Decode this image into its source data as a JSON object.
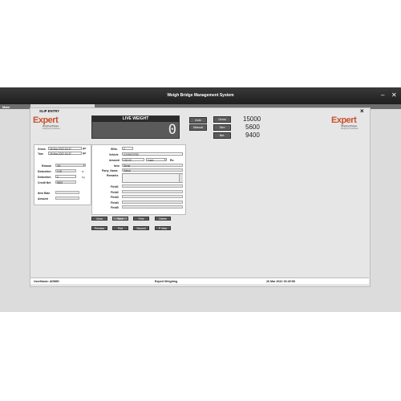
{
  "app": {
    "title": "Weigh Bridge Management System"
  },
  "menu": {
    "main": "Main",
    "strip": ""
  },
  "dialog": {
    "title": "SLIP ENTRY",
    "close": "×"
  },
  "window_controls": {
    "minimize": "–",
    "close": "✕"
  },
  "logo_left": {
    "brand": "Expert",
    "tagline": "Weighing Bridges",
    "sub": "Weighing Software"
  },
  "logo_right": {
    "brand": "Expert",
    "tagline": "Weighing Bridges",
    "sub": "Weighing Software"
  },
  "live_weight": {
    "label": "LIVE WEIGHT",
    "value": "0"
  },
  "mode_buttons": {
    "auto": "Auto",
    "manual": "Manual"
  },
  "weights": {
    "gross": {
      "label": "Gross",
      "value": "15000"
    },
    "tare": {
      "label": "Tare",
      "value": "5600"
    },
    "net": {
      "label": "Net.",
      "value": "9400"
    }
  },
  "left_panel": {
    "gross_label": "Gross",
    "gross_date": "26 Mar 2022 15:37",
    "tare_label": "Tare",
    "tare_date": "26 Mar 2022 15:37",
    "reason_label": "Reason",
    "reason_value": "OK",
    "deduction_label": "Deduction",
    "deduction_value": "2.00",
    "deduction_unit": "%",
    "deduction2_label": "Deduction",
    "deduction2_value": "0",
    "deduction2_unit": "Kg",
    "credit_net_label": "Credit Net",
    "credit_net_value": "9400",
    "item_rate_label": "Item Rate",
    "amount_label": "Amount"
  },
  "form": {
    "slip_label": "SlNo.",
    "slip_value": "2",
    "vehicle_label": "Vehicle",
    "vehicle_value": "GJ09DZ0750",
    "amount_label": "Amount",
    "amount_value": "100.00",
    "pay_value": "Cash",
    "rs_label": "Rs.",
    "item_label": "Item",
    "item_value": "Stone",
    "party_label": "Party_Name",
    "party_value": "Vishal",
    "remarks_label": "Remarks",
    "field1": "Field1",
    "field2": "Field2",
    "field3": "Field3",
    "field4": "Field4",
    "field5": "Field5"
  },
  "actions": {
    "clear": "Clear",
    "save": "Save",
    "print": "Print",
    "delete": "Delete",
    "preview": "Preview",
    "find": "Find",
    "second": "Second",
    "pview": "P View"
  },
  "status": {
    "user": "UserName: ADMIN",
    "center": "Expert Weighing",
    "datetime": "26 Mar 2022 15:45:58"
  }
}
